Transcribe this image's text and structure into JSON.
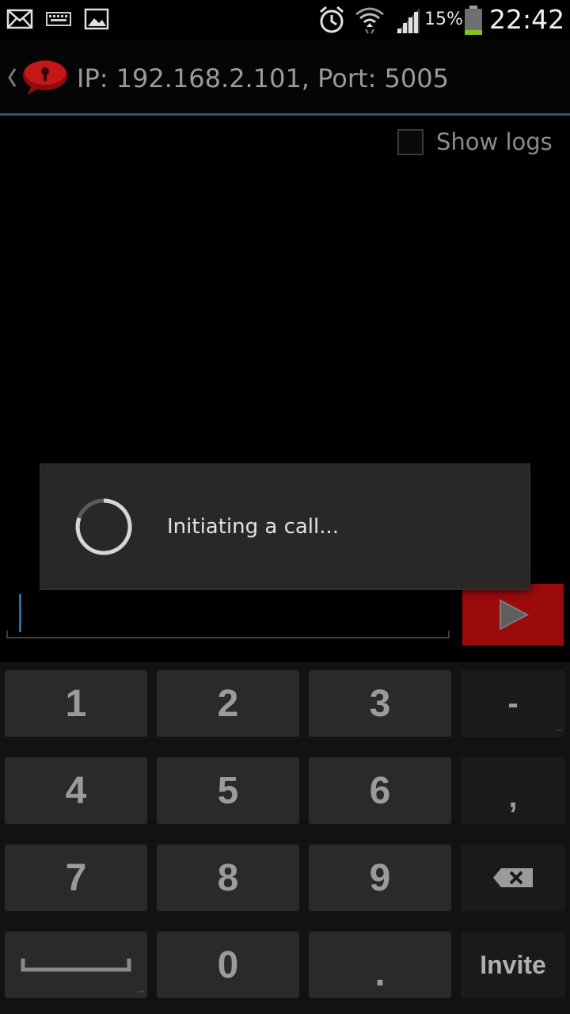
{
  "status_bar": {
    "battery_percent": "15%",
    "time": "22:42",
    "icons": [
      "mail-icon",
      "keyboard-icon",
      "image-icon",
      "alarm-icon",
      "wifi-icon",
      "signal-icon",
      "battery-icon"
    ]
  },
  "action_bar": {
    "title": "IP: 192.168.2.101, Port: 5005"
  },
  "show_logs": {
    "label": "Show logs",
    "checked": false
  },
  "dialog": {
    "message": "Initiating a call..."
  },
  "input": {
    "value": ""
  },
  "keypad": {
    "rows": [
      [
        "1",
        "2",
        "3",
        "-"
      ],
      [
        "4",
        "5",
        "6",
        ","
      ],
      [
        "7",
        "8",
        "9",
        "backspace"
      ],
      [
        "space",
        "0",
        ".",
        "Invite"
      ]
    ],
    "invite_label": "Invite"
  },
  "colors": {
    "accent_blue": "#2f5670",
    "send_red": "#9c0b0b",
    "battery_green": "#7fc31c"
  }
}
